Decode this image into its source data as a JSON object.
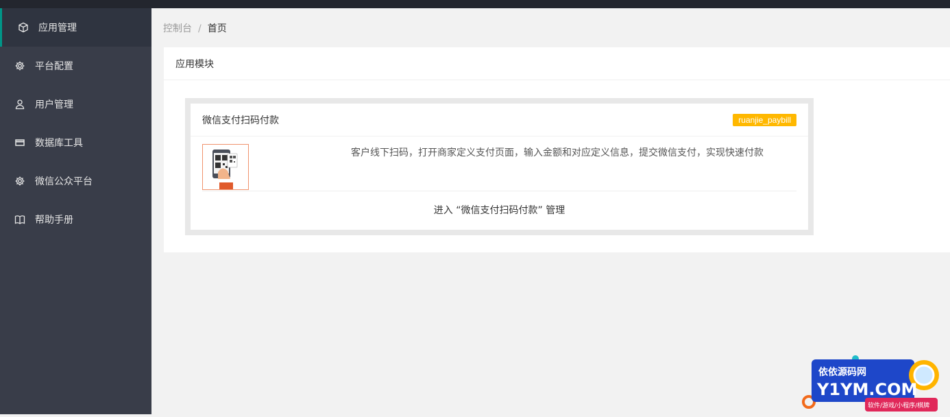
{
  "sidebar": {
    "items": [
      {
        "label": "应用管理",
        "icon": "cube-icon",
        "active": true
      },
      {
        "label": "平台配置",
        "icon": "gear-icon"
      },
      {
        "label": "用户管理",
        "icon": "user-icon"
      },
      {
        "label": "数据库工具",
        "icon": "database-icon"
      },
      {
        "label": "微信公众平台",
        "icon": "gear-icon"
      },
      {
        "label": "帮助手册",
        "icon": "book-icon"
      }
    ]
  },
  "breadcrumb": {
    "root": "控制台",
    "separator": "/",
    "current": "首页"
  },
  "panel": {
    "title": "应用模块"
  },
  "app_card": {
    "title": "微信支付扫码付款",
    "tag": "ruanjie_paybill",
    "description": "客户线下扫码，打开商家定义支付页面，输入金额和对应定义信息，提交微信支付，实现快速付款",
    "manage_link": "进入 “微信支付扫码付款” 管理",
    "thumbnail_icon": "qr-scan-phone-icon"
  },
  "watermark": {
    "line1": "依依源码网",
    "line2": "Y1YM.COM",
    "line3": "软件/游戏/小程序/棋牌"
  },
  "colors": {
    "sidebar_bg": "#393d49",
    "accent": "#009688",
    "badge": "#ffb800"
  }
}
